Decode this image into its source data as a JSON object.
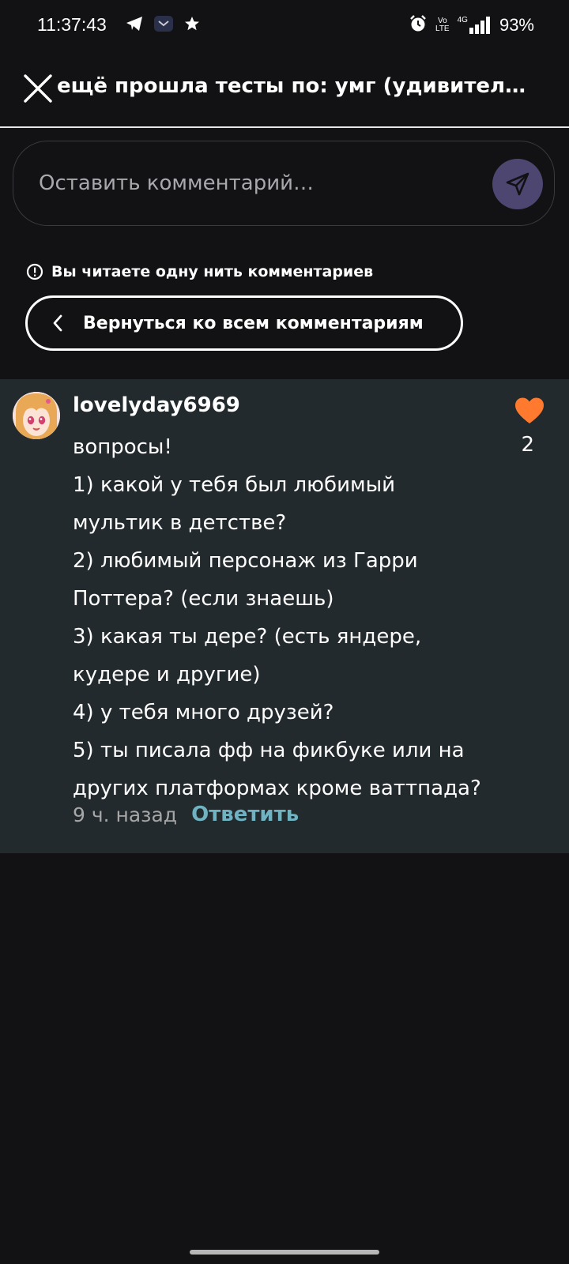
{
  "status_bar": {
    "time": "11:37:43",
    "battery": "93%",
    "volte_top": "Vo",
    "volte_bottom": "LTE",
    "network": "4G",
    "icons": [
      "telegram-icon",
      "mail-icon",
      "star-icon",
      "alarm-icon",
      "volte-icon",
      "signal-icon"
    ]
  },
  "header": {
    "title": "ещё прошла тесты по: умг (удивител…"
  },
  "comment_input": {
    "placeholder": "Оставить комментарий…"
  },
  "thread": {
    "notice": "Вы читаете одну нить комментариев",
    "back_label": "Вернуться ко всем комментариям"
  },
  "comment": {
    "username": "lovelyday6969",
    "lines": [
      "вопросы!",
      "1) какой у тебя был любимый",
      "мультик в детстве?",
      "2) любимый персонаж из Гарри",
      "Поттера? (если знаешь)",
      "3) какая ты дере? (есть яндере,",
      "кудере и другие)",
      "4) у тебя много друзей?",
      "5) ты писала фф на фикбуке или на",
      "других платформах кроме ваттпада?"
    ],
    "time_ago": "9 ч. назад",
    "reply_label": "Ответить",
    "like_count": "2"
  },
  "colors": {
    "background": "#121114",
    "card": "#222a2d",
    "accent_like": "#ff7a2f",
    "reply": "#6fb3c2",
    "send_button": "#4d4670"
  }
}
